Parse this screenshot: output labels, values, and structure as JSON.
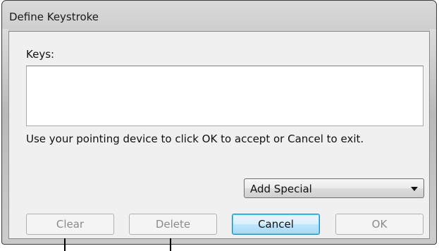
{
  "window": {
    "title": "Define Keystroke"
  },
  "keys": {
    "label": "Keys:",
    "value": ""
  },
  "hint": "Use your pointing device to click OK to accept or Cancel to exit.",
  "add_special": {
    "selected": "Add Special"
  },
  "buttons": {
    "clear": "Clear",
    "delete": "Delete",
    "cancel": "Cancel",
    "ok": "OK"
  },
  "colors": {
    "frame": "#cfcfcf",
    "client": "#f0f0f0",
    "disabled_text": "#8b8b8b"
  }
}
